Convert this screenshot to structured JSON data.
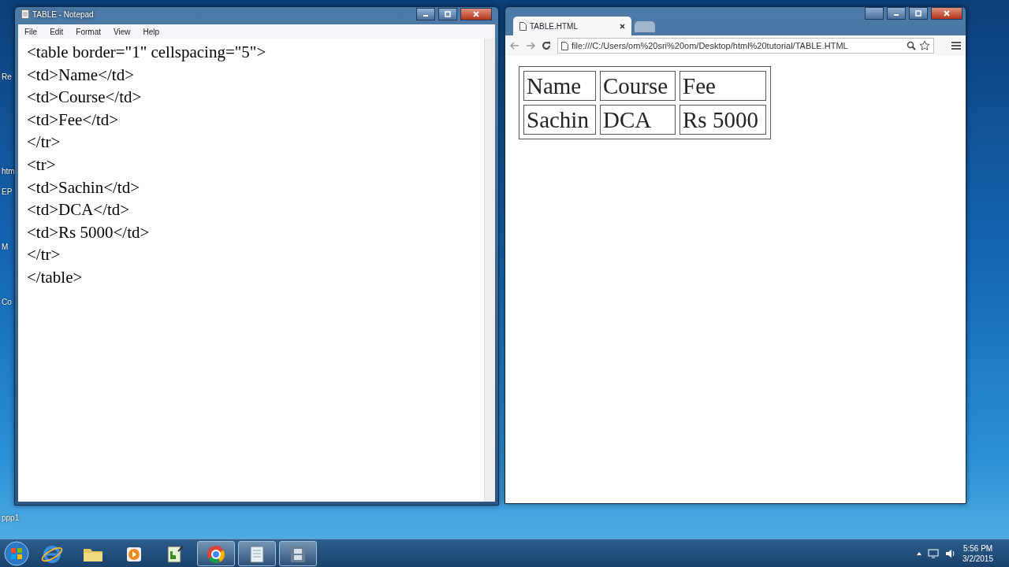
{
  "desktop_icons": [
    {
      "label": "Re"
    },
    {
      "label": "htm"
    },
    {
      "label": "EP"
    },
    {
      "label": "M"
    },
    {
      "label": "Co"
    },
    {
      "label": "ppp1"
    }
  ],
  "notepad": {
    "title": "TABLE - Notepad",
    "menu": [
      "File",
      "Edit",
      "Format",
      "View",
      "Help"
    ],
    "lines": [
      "<table border=\"1\" cellspacing=\"5\">",
      "<td>Name</td>",
      "<td>Course</td>",
      "<td>Fee</td>",
      "</tr>",
      "<tr>",
      "<td>Sachin</td>",
      "<td>DCA</td>",
      "<td>Rs 5000</td>",
      "</tr>",
      "</table>"
    ]
  },
  "browser": {
    "tab": {
      "title": "TABLE.HTML",
      "selected": true
    },
    "address": "file:///C:/Users/om%20sri%20om/Desktop/html%20tutorial/TABLE.HTML",
    "table": {
      "rows": [
        [
          "Name",
          "Course",
          "Fee"
        ],
        [
          "Sachin",
          "DCA",
          "Rs 5000"
        ]
      ]
    }
  },
  "taskbar": {
    "apps": [
      {
        "kind": "ie",
        "active": false
      },
      {
        "kind": "folder",
        "active": false
      },
      {
        "kind": "media",
        "active": false
      },
      {
        "kind": "editor",
        "active": false
      },
      {
        "kind": "chrome",
        "active": true
      },
      {
        "kind": "notepad",
        "active": true
      },
      {
        "kind": "film",
        "active": true
      }
    ],
    "time": "5:56 PM",
    "date": "3/2/2015"
  }
}
